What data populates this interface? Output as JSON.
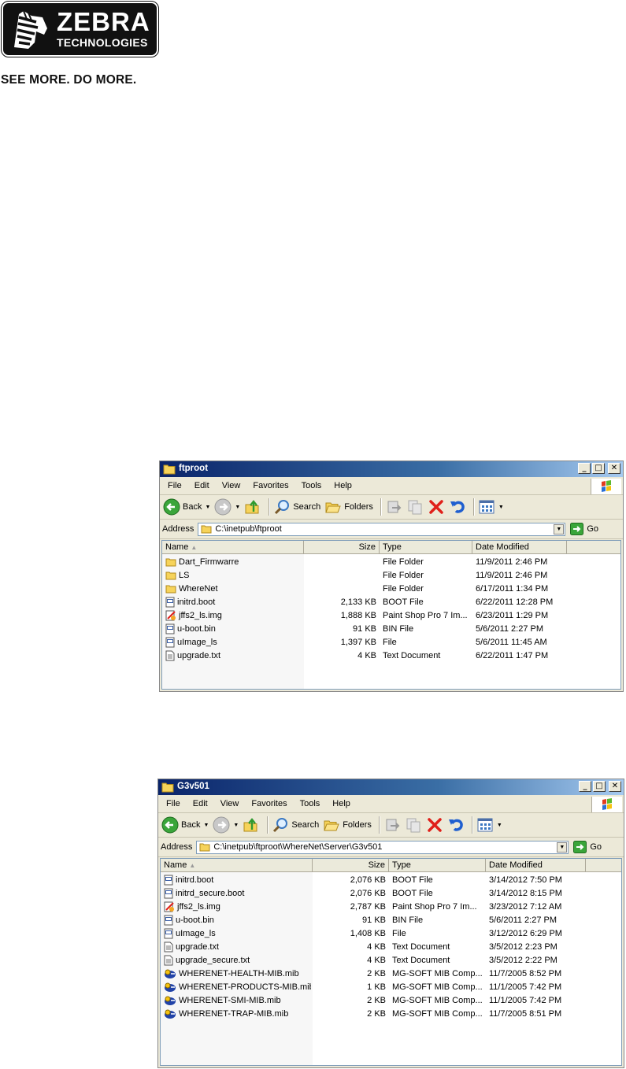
{
  "logo": {
    "brand": "ZEBRA",
    "sub": "TECHNOLOGIES",
    "tagline": "SEE MORE. DO MORE."
  },
  "menu": [
    "File",
    "Edit",
    "View",
    "Favorites",
    "Tools",
    "Help"
  ],
  "toolbar": {
    "back": "Back",
    "search": "Search",
    "folders": "Folders"
  },
  "address_label": "Address",
  "go_label": "Go",
  "columns": {
    "name": "Name",
    "size": "Size",
    "type": "Type",
    "date": "Date Modified"
  },
  "colors": {
    "title_start": "#0a246a",
    "title_end": "#a6caf0",
    "window_bg": "#ece9d8",
    "delete_red": "#e0201a"
  },
  "windows": [
    {
      "title": "ftproot",
      "address": "C:\\inetpub\\ftproot",
      "files": [
        {
          "name": "Dart_Firmwarre",
          "size": "",
          "type": "File Folder",
          "date": "11/9/2011 2:46 PM",
          "icon": "folder-icon"
        },
        {
          "name": "LS",
          "size": "",
          "type": "File Folder",
          "date": "11/9/2011 2:46 PM",
          "icon": "folder-icon"
        },
        {
          "name": "WhereNet",
          "size": "",
          "type": "File Folder",
          "date": "6/17/2011 1:34 PM",
          "icon": "folder-icon"
        },
        {
          "name": "initrd.boot",
          "size": "2,133 KB",
          "type": "BOOT File",
          "date": "6/22/2011 12:28 PM",
          "icon": "file-icon"
        },
        {
          "name": "jffs2_ls.img",
          "size": "1,888 KB",
          "type": "Paint Shop Pro 7 Im...",
          "date": "6/23/2011 1:29 PM",
          "icon": "image-file-icon"
        },
        {
          "name": "u-boot.bin",
          "size": "91 KB",
          "type": "BIN File",
          "date": "5/6/2011 2:27 PM",
          "icon": "file-icon"
        },
        {
          "name": "uImage_ls",
          "size": "1,397 KB",
          "type": "File",
          "date": "5/6/2011 11:45 AM",
          "icon": "file-icon"
        },
        {
          "name": "upgrade.txt",
          "size": "4 KB",
          "type": "Text Document",
          "date": "6/22/2011 1:47 PM",
          "icon": "text-file-icon"
        }
      ]
    },
    {
      "title": "G3v501",
      "address": "C:\\inetpub\\ftproot\\WhereNet\\Server\\G3v501",
      "files": [
        {
          "name": "initrd.boot",
          "size": "2,076 KB",
          "type": "BOOT File",
          "date": "3/14/2012 7:50 PM",
          "icon": "file-icon"
        },
        {
          "name": "initrd_secure.boot",
          "size": "2,076 KB",
          "type": "BOOT File",
          "date": "3/14/2012 8:15 PM",
          "icon": "file-icon"
        },
        {
          "name": "jffs2_ls.img",
          "size": "2,787 KB",
          "type": "Paint Shop Pro 7 Im...",
          "date": "3/23/2012 7:12 AM",
          "icon": "image-file-icon"
        },
        {
          "name": "u-boot.bin",
          "size": "91 KB",
          "type": "BIN File",
          "date": "5/6/2011 2:27 PM",
          "icon": "file-icon"
        },
        {
          "name": "uImage_ls",
          "size": "1,408 KB",
          "type": "File",
          "date": "3/12/2012 6:29 PM",
          "icon": "file-icon"
        },
        {
          "name": "upgrade.txt",
          "size": "4 KB",
          "type": "Text Document",
          "date": "3/5/2012 2:23 PM",
          "icon": "text-file-icon"
        },
        {
          "name": "upgrade_secure.txt",
          "size": "4 KB",
          "type": "Text Document",
          "date": "3/5/2012 2:22 PM",
          "icon": "text-file-icon"
        },
        {
          "name": "WHERENET-HEALTH-MIB.mib",
          "size": "2 KB",
          "type": "MG-SOFT MIB Comp...",
          "date": "11/7/2005 8:52 PM",
          "icon": "mib-file-icon"
        },
        {
          "name": "WHERENET-PRODUCTS-MIB.mib",
          "size": "1 KB",
          "type": "MG-SOFT MIB Comp...",
          "date": "11/1/2005 7:42 PM",
          "icon": "mib-file-icon"
        },
        {
          "name": "WHERENET-SMI-MIB.mib",
          "size": "2 KB",
          "type": "MG-SOFT MIB Comp...",
          "date": "11/1/2005 7:42 PM",
          "icon": "mib-file-icon"
        },
        {
          "name": "WHERENET-TRAP-MIB.mib",
          "size": "2 KB",
          "type": "MG-SOFT MIB Comp...",
          "date": "11/7/2005 8:51 PM",
          "icon": "mib-file-icon"
        }
      ]
    }
  ]
}
